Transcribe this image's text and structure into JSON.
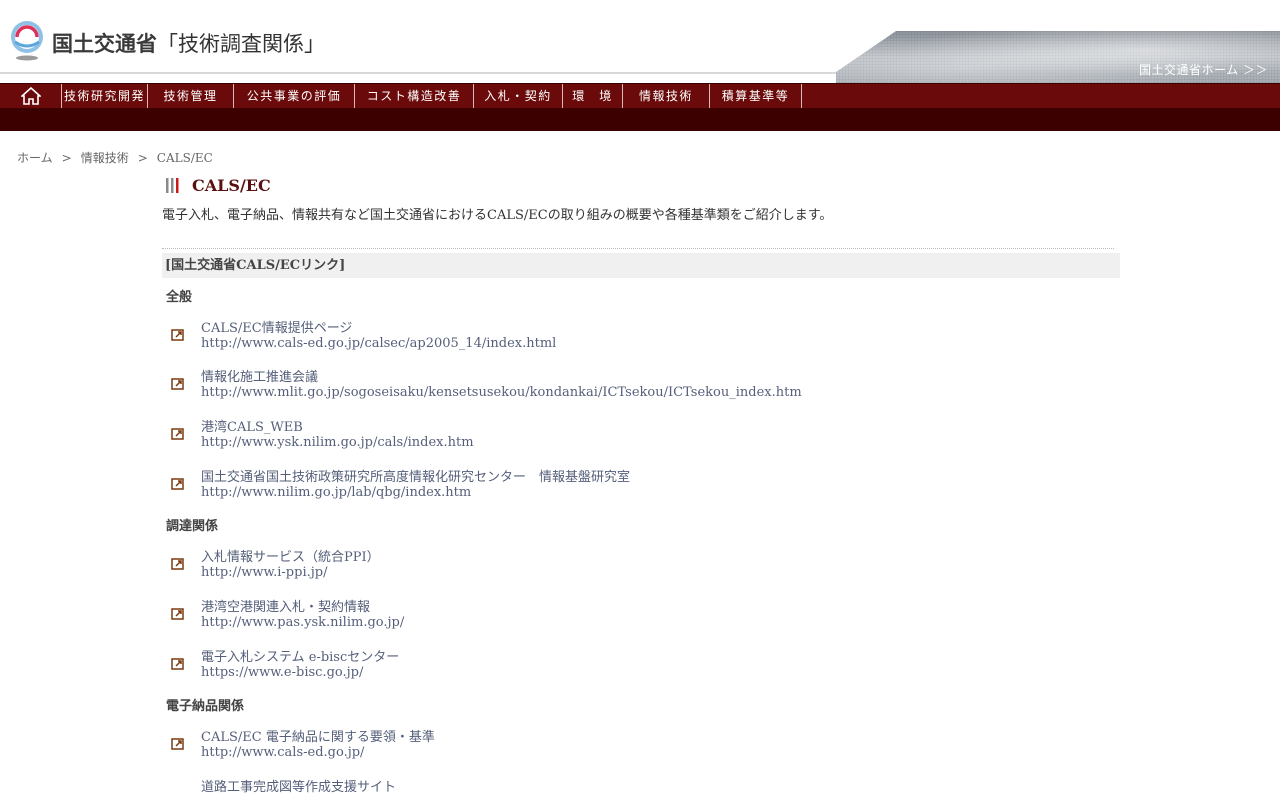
{
  "header": {
    "site_title_main": "国土交通省",
    "site_title_sub": "「技術調査関係」",
    "mlit_home_link": "国土交通省ホーム ＞＞"
  },
  "nav": {
    "home_icon": "home-icon",
    "items": [
      "技術研究開発",
      "技術管理",
      "公共事業の評価",
      "コスト構造改善",
      "入札・契約",
      "環　境",
      "情報技術",
      "積算基準等"
    ]
  },
  "breadcrumb": {
    "home": "ホーム",
    "sep": ">",
    "parent": "情報技術",
    "current": "CALS/EC"
  },
  "page": {
    "title": "CALS/EC",
    "intro": "電子入札、電子納品、情報共有など国土交通省におけるCALS/ECの取り組みの概要や各種基準類をご紹介します。"
  },
  "section": {
    "heading": "[国土交通省CALS/ECリンク]",
    "groups": [
      {
        "heading": "全般",
        "links": [
          {
            "title": "CALS/EC情報提供ページ",
            "url": "http://www.cals-ed.go.jp/calsec/ap2005_14/index.html"
          },
          {
            "title": "情報化施工推進会議",
            "url": "http://www.mlit.go.jp/sogoseisaku/kensetsusekou/kondankai/ICTsekou/ICTsekou_index.htm"
          },
          {
            "title": "港湾CALS_WEB",
            "url": "http://www.ysk.nilim.go.jp/cals/index.htm"
          },
          {
            "title": "国土交通省国土技術政策研究所高度情報化研究センター　情報基盤研究室",
            "url": "http://www.nilim.go.jp/lab/qbg/index.htm"
          }
        ]
      },
      {
        "heading": "調達関係",
        "links": [
          {
            "title": "入札情報サービス（統合PPI）",
            "url": "http://www.i-ppi.jp/"
          },
          {
            "title": "港湾空港関連入札・契約情報",
            "url": "http://www.pas.ysk.nilim.go.jp/"
          },
          {
            "title": "電子入札システム e-biscセンター",
            "url": "https://www.e-bisc.go.jp/"
          }
        ]
      },
      {
        "heading": "電子納品関係",
        "links": [
          {
            "title": "CALS/EC 電子納品に関する要領・基準",
            "url": "http://www.cals-ed.go.jp/"
          },
          {
            "title": "道路工事完成図等作成支援サイト",
            "url": ""
          }
        ]
      }
    ]
  },
  "colors": {
    "nav_bg": "#6b0a0a",
    "subbar_bg": "#3d0000",
    "link": "#555f7a",
    "title": "#5a1010"
  }
}
